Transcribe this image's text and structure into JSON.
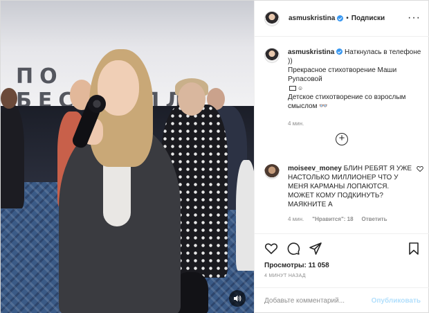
{
  "media": {
    "screen_text": "ПО БЕСТСЕЛЛЕР",
    "sound_icon": "volume-icon"
  },
  "header": {
    "username": "asmuskristina",
    "separator": "•",
    "follow_label": "Подписки",
    "more_icon": "more-options-icon"
  },
  "caption": {
    "username": "asmuskristina",
    "lines": [
      "Наткнулась в телефоне ))",
      "Прекрасное стихотворение Маши Рупасовой",
      "Детское стихотворение со взрослым смыслом"
    ],
    "time": "4 мин."
  },
  "comment": {
    "username": "moiseev_money",
    "text": "БЛИН РЕБЯТ Я УЖЕ НАСТОЛЬКО МИЛЛИОНЕР ЧТО У МЕНЯ КАРМАНЫ ЛОПАЮТСЯ. МОЖЕТ КОМУ ПОДКИНУТЬ? МАЯКНИТЕ А",
    "time": "4 мин.",
    "likes": "\"Нравится\": 18",
    "reply": "Ответить"
  },
  "actions": {
    "views": "Просмотры: 11 058",
    "ago": "4 МИНУТ НАЗАД"
  },
  "add_comment": {
    "placeholder": "Добавьте комментарий...",
    "publish": "Опубликовать"
  },
  "colors": {
    "verified": "#3897f0",
    "publish_disabled": "#b2dffc",
    "border": "#efefef"
  }
}
